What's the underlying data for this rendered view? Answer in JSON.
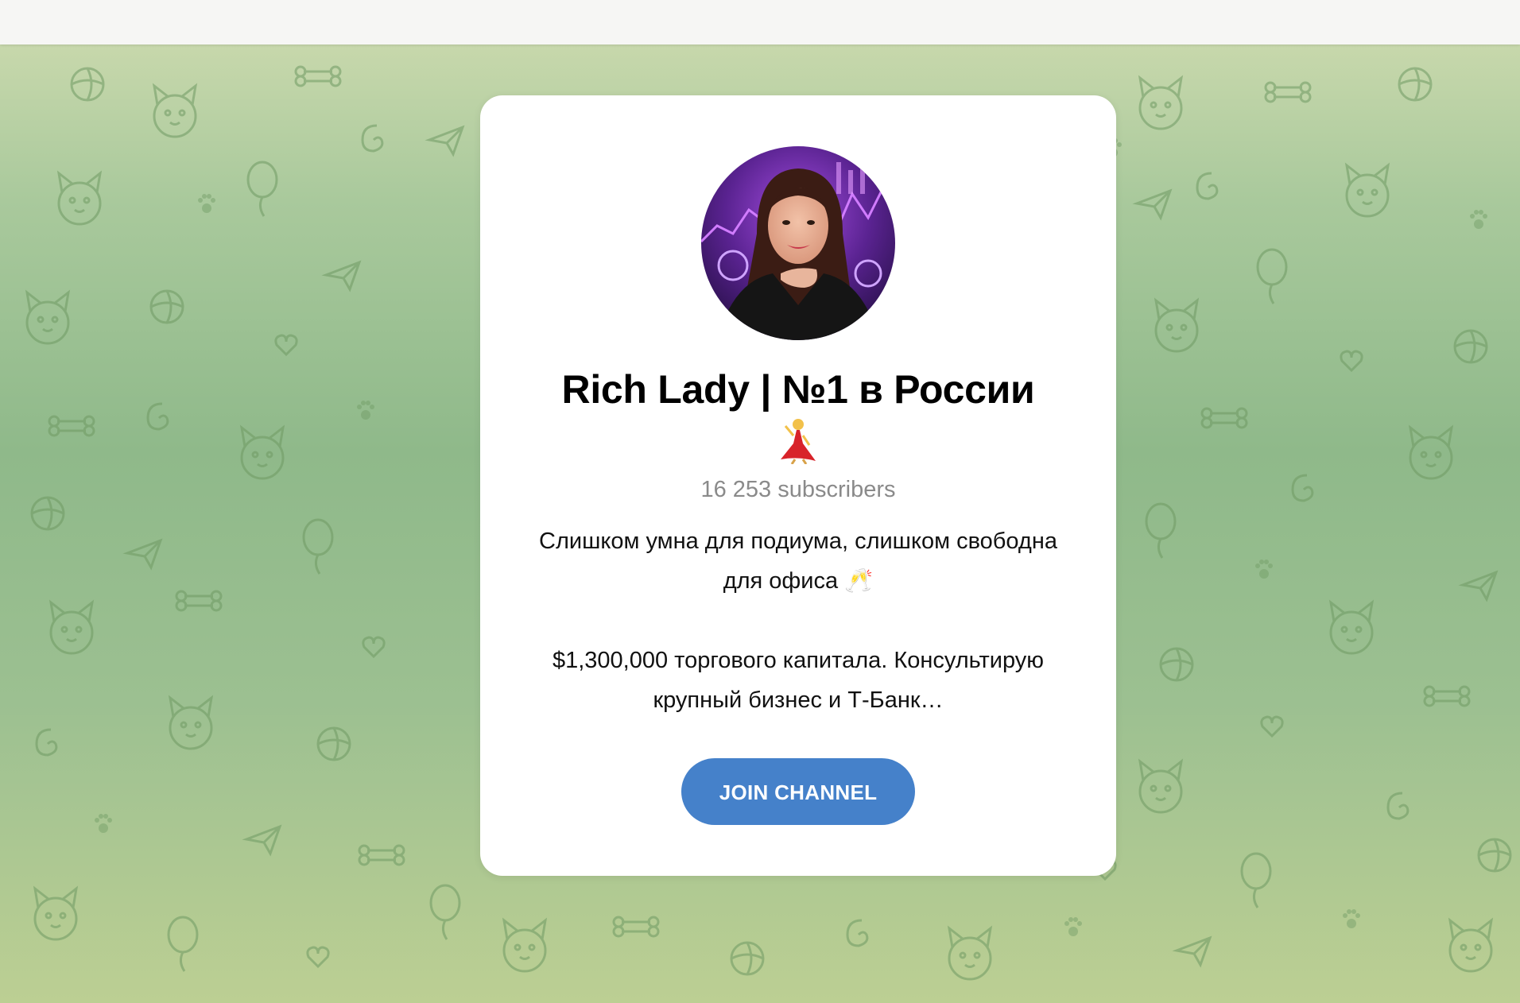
{
  "channel": {
    "title": "Rich Lady | №1 в России",
    "subscribers": "16 253 subscribers",
    "description_line1": "Слишком умна для подиума, слишком свободна",
    "description_line2": "для офиса 🥂",
    "description_line3": "$1,300,000 торгового капитала. Консультирую",
    "description_line4": "крупный бизнес и Т-Банк…",
    "join_label": "JOIN CHANNEL"
  },
  "colors": {
    "button": "#4581ca",
    "background_green": "#8fb98a",
    "subscribers_text": "#8a8a8a"
  }
}
